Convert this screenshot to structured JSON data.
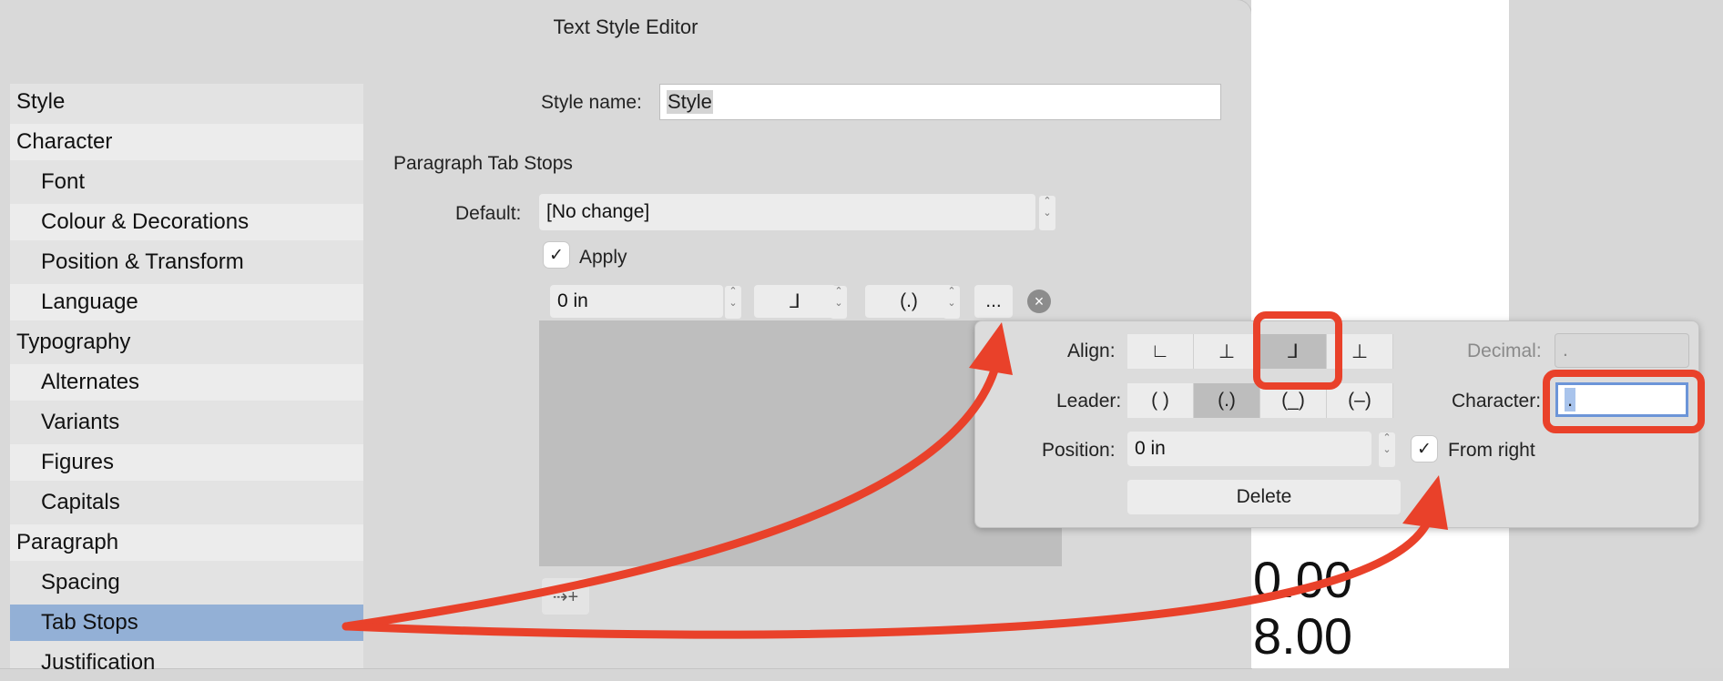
{
  "window": {
    "title": "Text Style Editor"
  },
  "sidebar": {
    "items": [
      {
        "label": "Style",
        "level": "top"
      },
      {
        "label": "Character",
        "level": "top"
      },
      {
        "label": "Font",
        "level": "sub"
      },
      {
        "label": "Colour & Decorations",
        "level": "sub"
      },
      {
        "label": "Position & Transform",
        "level": "sub"
      },
      {
        "label": "Language",
        "level": "sub"
      },
      {
        "label": "Typography",
        "level": "top"
      },
      {
        "label": "Alternates",
        "level": "sub"
      },
      {
        "label": "Variants",
        "level": "sub"
      },
      {
        "label": "Figures",
        "level": "sub"
      },
      {
        "label": "Capitals",
        "level": "sub"
      },
      {
        "label": "Paragraph",
        "level": "top"
      },
      {
        "label": "Spacing",
        "level": "sub"
      },
      {
        "label": "Tab Stops",
        "level": "sub",
        "selected": true
      },
      {
        "label": "Justification",
        "level": "sub"
      }
    ]
  },
  "form": {
    "style_name_label": "Style name:",
    "style_name_value": "Style",
    "section_title": "Paragraph Tab Stops",
    "default_label": "Default:",
    "default_value": "[No change]",
    "apply_label": "Apply",
    "apply_checked": true,
    "tab_row": {
      "position": "0 in",
      "align_glyph": "⅃",
      "leader_glyph": "(.)",
      "more_label": "..."
    }
  },
  "popover": {
    "align_label": "Align:",
    "align_options": [
      "∟",
      "⊥",
      "⅃",
      "⊥"
    ],
    "align_selected": 2,
    "decimal_label": "Decimal:",
    "decimal_value": ".",
    "leader_label": "Leader:",
    "leader_options": [
      "( )",
      "(.)",
      "(_)",
      "(–)"
    ],
    "leader_selected": 1,
    "character_label": "Character:",
    "character_value": ".",
    "position_label": "Position:",
    "position_value": "0 in",
    "from_right_label": "From right",
    "from_right_checked": true,
    "delete_label": "Delete"
  },
  "document": {
    "line1": "0.00",
    "line2": "8.00"
  },
  "colors": {
    "annotation": "#e9412a",
    "selection": "#93b0d6"
  },
  "icons": {
    "checkmark": "check-icon",
    "clear": "clear-circle-icon",
    "add_tab": "add-tab-stop-icon"
  }
}
